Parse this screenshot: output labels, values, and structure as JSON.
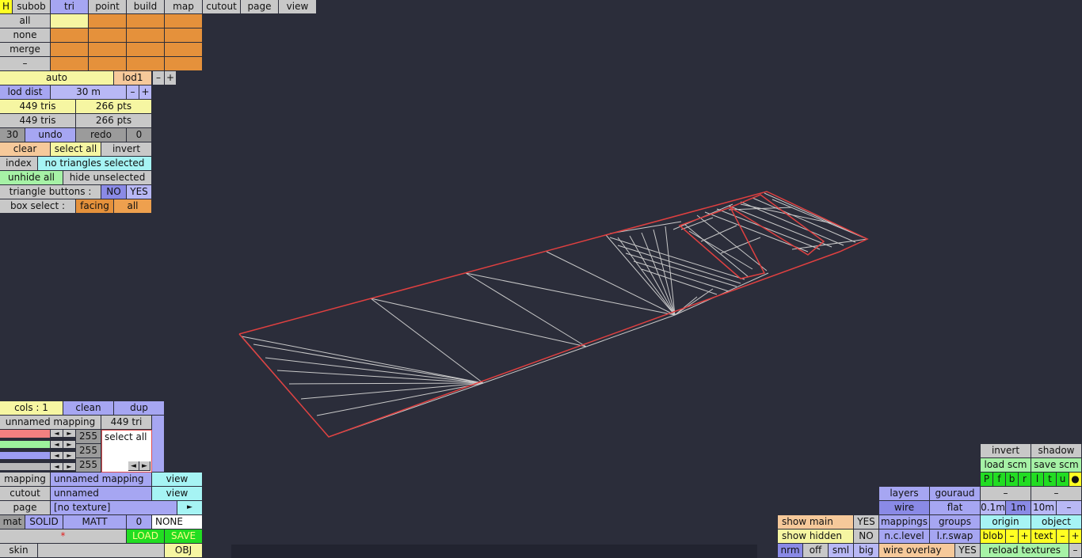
{
  "top_menu": {
    "h": "H",
    "subob": "subob",
    "tri": "tri",
    "point": "point",
    "build": "build",
    "map": "map",
    "cutout": "cutout",
    "page": "page",
    "view": "view"
  },
  "left": {
    "all": "all",
    "none": "none",
    "merge": "merge",
    "minus": "–",
    "auto": "auto",
    "lod1": "lod1",
    "lod_minus": "–",
    "lod_plus": "+",
    "lod_dist": "lod dist",
    "lod_dist_val": "30 m",
    "ld_minus": "–",
    "ld_plus": "+",
    "tris1": "449 tris",
    "pts1": "266 pts",
    "tris2": "449 tris",
    "pts2": "266 pts",
    "undo_count": "30",
    "undo": "undo",
    "redo": "redo",
    "redo_count": "0",
    "clear": "clear",
    "select_all": "select all",
    "invert": "invert",
    "index": "index",
    "selection_status": "no triangles selected",
    "unhide_all": "unhide all",
    "hide_unselected": "hide unselected",
    "triangle_buttons": "triangle buttons :",
    "no": "NO",
    "yes": "YES",
    "box_select": "box select :",
    "facing": "facing",
    "box_all": "all"
  },
  "bottom_left": {
    "cols": "cols : 1",
    "clean": "clean",
    "dup": "dup",
    "unnamed_mapping": "unnamed mapping",
    "tri_count": "449 tri",
    "r": "255",
    "g": "255",
    "b": "255",
    "select_all": "select all",
    "left_arrow": "◄",
    "right_arrow": "►",
    "mapping": "mapping",
    "mapping_val": "unnamed mapping",
    "view1": "view",
    "cutout": "cutout",
    "cutout_val": "unnamed",
    "view2": "view",
    "page": "page",
    "page_val": "[no texture]",
    "page_arrow": "►",
    "mat": "mat",
    "solid": "SOLID",
    "matt": "MATT",
    "zero": "0",
    "none": "NONE",
    "star": "*",
    "load": "LOAD",
    "save": "SAVE",
    "skin": "skin",
    "obj": "OBJ"
  },
  "bottom_right": {
    "invert": "invert",
    "shadow": "shadow",
    "load_scm": "load scm",
    "save_scm": "save scm",
    "flags": [
      "P",
      "f",
      "b",
      "r",
      "l",
      "t",
      "u",
      "●"
    ],
    "dash1": "–",
    "dash2": "–",
    "layers": "layers",
    "gouraud": "gouraud",
    "wire": "wire",
    "flat": "flat",
    "d01": "0.1m",
    "d1": "1m",
    "d10": "10m",
    "dminus": "–",
    "show_main": "show main",
    "show_main_val": "YES",
    "mappings": "mappings",
    "groups": "groups",
    "origin": "origin",
    "object": "object",
    "show_hidden": "show hidden",
    "show_hidden_val": "NO",
    "nc_level": "n.c.level",
    "lr_swap": "l.r.swap",
    "blob": "blob",
    "blob_minus": "–",
    "blob_plus": "+",
    "text": "text",
    "text_minus": "–",
    "text_plus": "+",
    "nrm": "nrm",
    "off": "off",
    "sml": "sml",
    "big": "big",
    "wire_overlay": "wire overlay",
    "wire_overlay_val": "YES",
    "reload_textures": "reload textures",
    "last_minus": "–"
  },
  "colors": {
    "background": "#2b2d3a",
    "wire": "#c9c9c9",
    "outline": "#e04040"
  }
}
